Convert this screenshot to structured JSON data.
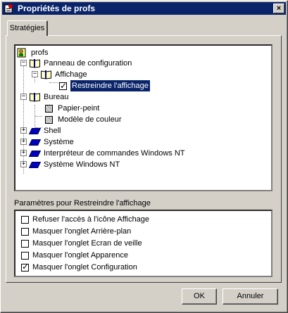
{
  "window": {
    "title": "Propriétés de profs",
    "close_label": "×"
  },
  "tabs": [
    {
      "label": "Stratégies"
    }
  ],
  "tree": {
    "root": "profs",
    "items": [
      {
        "label": "Panneau de configuration",
        "icon": "open-book-icon"
      },
      {
        "label": "Affichage",
        "icon": "open-book-icon"
      },
      {
        "label": "Restreindre l'affichage",
        "checked": true,
        "selected": true
      },
      {
        "label": "Bureau",
        "icon": "open-book-icon"
      },
      {
        "label": "Papier-peint",
        "state": "indeterminate"
      },
      {
        "label": "Modèle de couleur",
        "state": "indeterminate"
      },
      {
        "label": "Shell",
        "icon": "closed-book-icon"
      },
      {
        "label": "Système",
        "icon": "closed-book-icon"
      },
      {
        "label": "Interpréteur de commandes Windows NT",
        "icon": "closed-book-icon"
      },
      {
        "label": "Système Windows NT",
        "icon": "closed-book-icon"
      }
    ]
  },
  "params": {
    "heading": "Paramètres pour Restreindre l'affichage",
    "options": [
      {
        "label": "Refuser l'accès à l'icône Affichage",
        "checked": false
      },
      {
        "label": "Masquer l'onglet Arrière-plan",
        "checked": false
      },
      {
        "label": "Masquer l'onglet Ecran de veille",
        "checked": false
      },
      {
        "label": "Masquer l'onglet Apparence",
        "checked": false
      },
      {
        "label": "Masquer l'onglet Configuration",
        "checked": true
      }
    ]
  },
  "buttons": {
    "ok": "OK",
    "cancel": "Annuler"
  }
}
